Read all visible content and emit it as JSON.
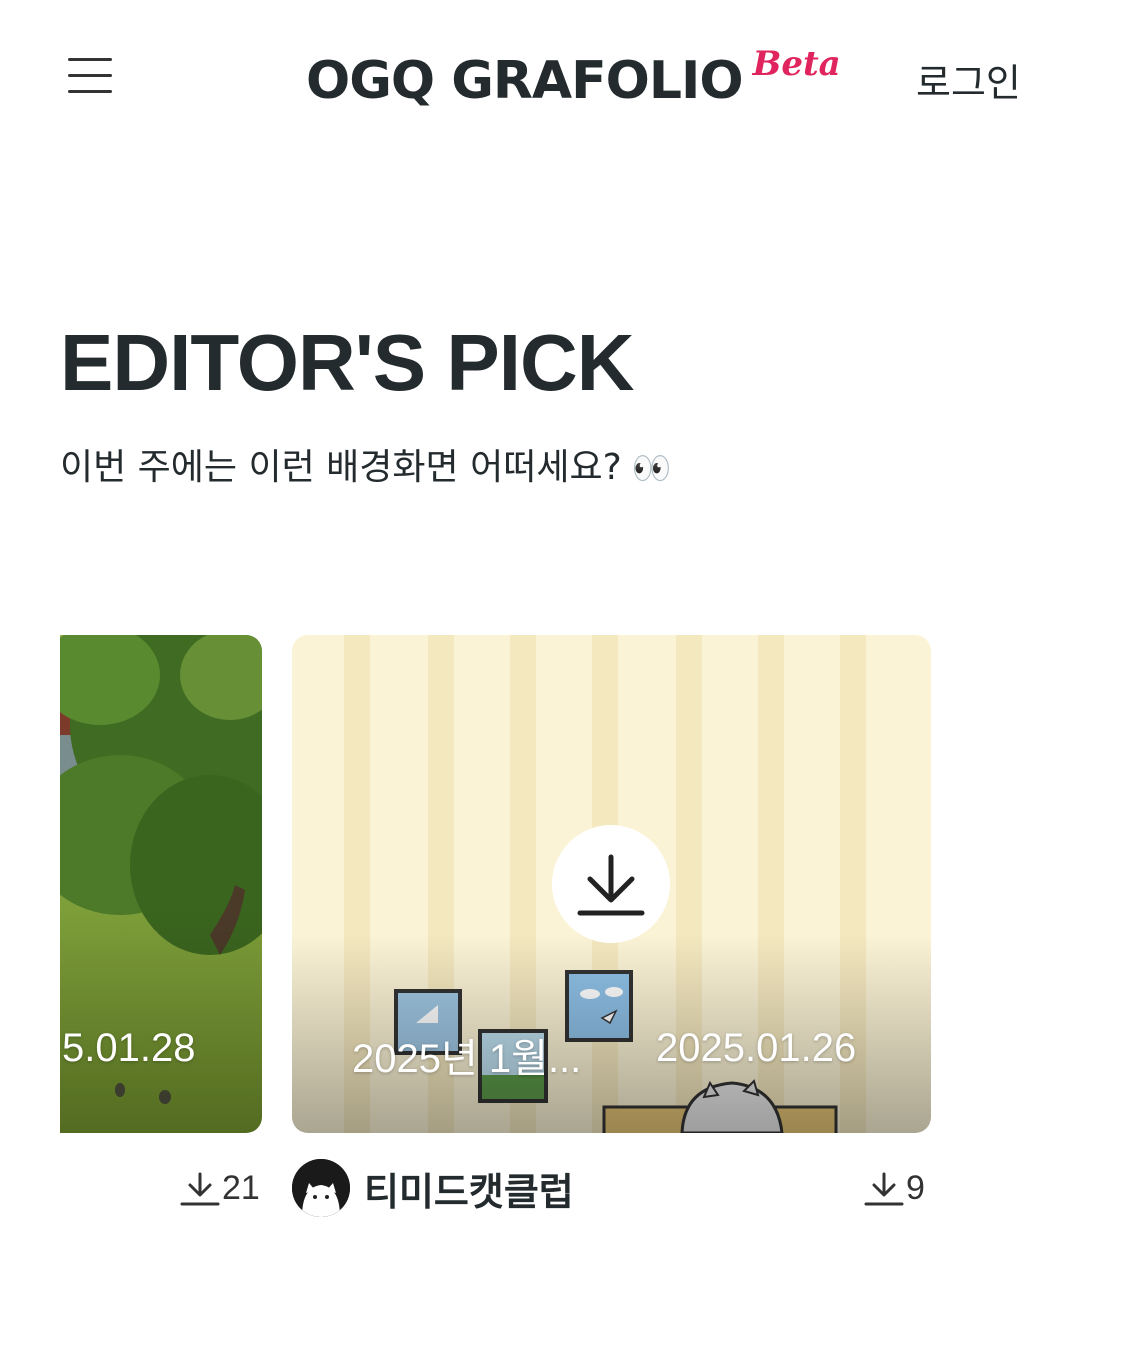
{
  "header": {
    "logo_text": "OGQ GRAFOLIO",
    "logo_badge": "Beta",
    "login_label": "로그인",
    "menu_icon": "hamburger-menu-icon"
  },
  "section": {
    "title": "EDITOR'S PICK",
    "subtitle": "이번 주에는 이런 배경화면 어떠세요?",
    "subtitle_emoji": "👀"
  },
  "cards": [
    {
      "date": "5.01.28",
      "download_count": "21"
    },
    {
      "title": "2025년 1월...",
      "date": "2025.01.26",
      "author": "티미드캣클럽",
      "download_count": "9"
    }
  ],
  "colors": {
    "text": "#242b2e",
    "beta": "#e0245e",
    "card_bg": "#fbf3d5"
  }
}
